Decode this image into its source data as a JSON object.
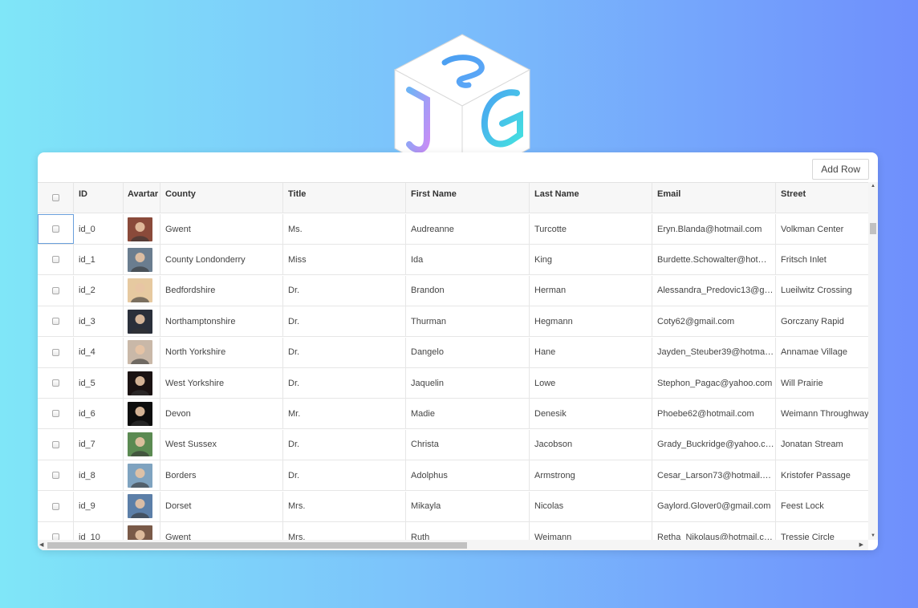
{
  "toolbar": {
    "add_row_label": "Add Row"
  },
  "columns": [
    "ID",
    "Avartar",
    "County",
    "Title",
    "First Name",
    "Last Name",
    "Email",
    "Street"
  ],
  "rows": [
    {
      "id": "id_0",
      "avatar": "photo-0",
      "county": "Gwent",
      "title": "Ms.",
      "first": "Audreanne",
      "last": "Turcotte",
      "email": "Eryn.Blanda@hotmail.com",
      "street": "Volkman Center"
    },
    {
      "id": "id_1",
      "avatar": "photo-1",
      "county": "County Londonderry",
      "title": "Miss",
      "first": "Ida",
      "last": "King",
      "email": "Burdette.Schowalter@hot…",
      "street": "Fritsch Inlet"
    },
    {
      "id": "id_2",
      "avatar": "photo-2",
      "county": "Bedfordshire",
      "title": "Dr.",
      "first": "Brandon",
      "last": "Herman",
      "email": "Alessandra_Predovic13@g…",
      "street": "Lueilwitz Crossing"
    },
    {
      "id": "id_3",
      "avatar": "photo-3",
      "county": "Northamptonshire",
      "title": "Dr.",
      "first": "Thurman",
      "last": "Hegmann",
      "email": "Coty62@gmail.com",
      "street": "Gorczany Rapid"
    },
    {
      "id": "id_4",
      "avatar": "photo-4",
      "county": "North Yorkshire",
      "title": "Dr.",
      "first": "Dangelo",
      "last": "Hane",
      "email": "Jayden_Steuber39@hotma…",
      "street": "Annamae Village"
    },
    {
      "id": "id_5",
      "avatar": "photo-5",
      "county": "West Yorkshire",
      "title": "Dr.",
      "first": "Jaquelin",
      "last": "Lowe",
      "email": "Stephon_Pagac@yahoo.com",
      "street": "Will Prairie"
    },
    {
      "id": "id_6",
      "avatar": "photo-6",
      "county": "Devon",
      "title": "Mr.",
      "first": "Madie",
      "last": "Denesik",
      "email": "Phoebe62@hotmail.com",
      "street": "Weimann Throughway"
    },
    {
      "id": "id_7",
      "avatar": "photo-7",
      "county": "West Sussex",
      "title": "Dr.",
      "first": "Christa",
      "last": "Jacobson",
      "email": "Grady_Buckridge@yahoo.c…",
      "street": "Jonatan Stream"
    },
    {
      "id": "id_8",
      "avatar": "photo-8",
      "county": "Borders",
      "title": "Dr.",
      "first": "Adolphus",
      "last": "Armstrong",
      "email": "Cesar_Larson73@hotmail.…",
      "street": "Kristofer Passage"
    },
    {
      "id": "id_9",
      "avatar": "photo-9",
      "county": "Dorset",
      "title": "Mrs.",
      "first": "Mikayla",
      "last": "Nicolas",
      "email": "Gaylord.Glover0@gmail.com",
      "street": "Feest Lock"
    },
    {
      "id": "id_10",
      "avatar": "photo-10",
      "county": "Gwent",
      "title": "Mrs.",
      "first": "Ruth",
      "last": "Weimann",
      "email": "Retha_Nikolaus@hotmail.c…",
      "street": "Tressie Circle"
    }
  ],
  "avatar_colors": [
    "#8a4a3a",
    "#6a7d8f",
    "#e6c9a0",
    "#2a2f3a",
    "#c9b8a8",
    "#1a1212",
    "#0d0d0d",
    "#5b8a52",
    "#7fa3c0",
    "#5c7fa8",
    "#7a5a48"
  ],
  "logo": {
    "icon": "cube-logo-icon",
    "colors": [
      "#4aa0f0",
      "#c58cf5",
      "#3fd7e6"
    ]
  }
}
